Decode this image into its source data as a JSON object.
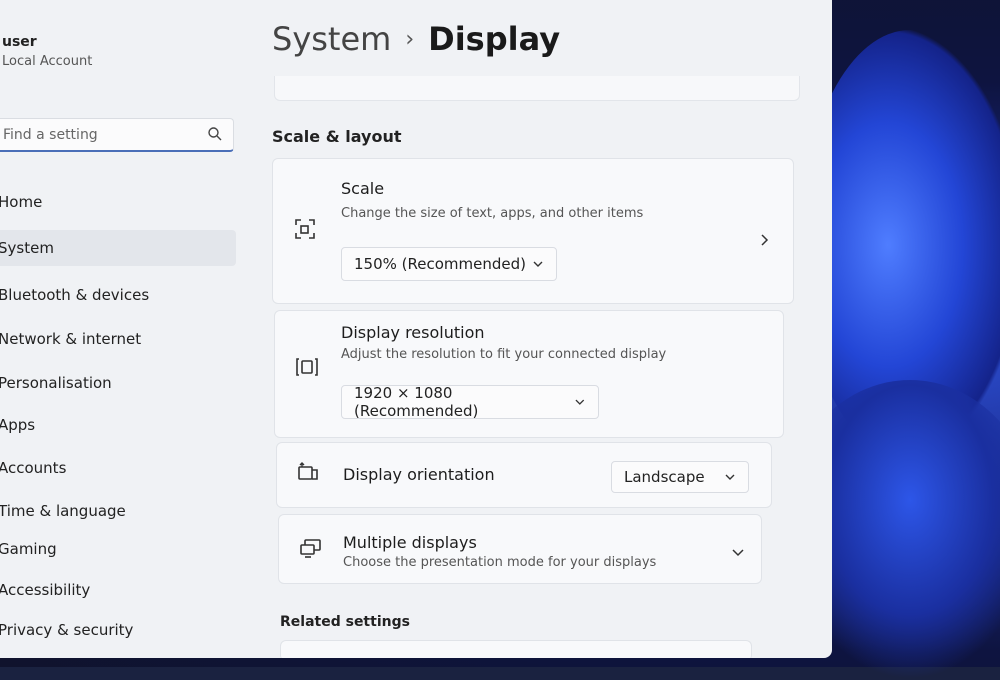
{
  "user": {
    "name": "user",
    "account": "Local Account"
  },
  "search": {
    "placeholder": "Find a setting"
  },
  "sidebar": {
    "items": [
      {
        "label": "Home"
      },
      {
        "label": "System"
      },
      {
        "label": "Bluetooth & devices"
      },
      {
        "label": "Network & internet"
      },
      {
        "label": "Personalisation"
      },
      {
        "label": "Apps"
      },
      {
        "label": "Accounts"
      },
      {
        "label": "Time & language"
      },
      {
        "label": "Gaming"
      },
      {
        "label": "Accessibility"
      },
      {
        "label": "Privacy & security"
      }
    ],
    "active_index": 1
  },
  "breadcrumb": {
    "parent": "System",
    "separator": "›",
    "current": "Display"
  },
  "section": {
    "title": "Scale & layout"
  },
  "scale": {
    "title": "Scale",
    "subtitle": "Change the size of text, apps, and other items",
    "value": "150% (Recommended)",
    "icon": "scale-icon"
  },
  "resolution": {
    "title": "Display resolution",
    "subtitle": "Adjust the resolution to fit your connected display",
    "value": "1920 × 1080 (Recommended)",
    "icon": "resolution-icon"
  },
  "orientation": {
    "title": "Display orientation",
    "value": "Landscape",
    "icon": "orientation-icon"
  },
  "multiple": {
    "title": "Multiple displays",
    "subtitle": "Choose the presentation mode for your displays",
    "icon": "multiple-displays-icon"
  },
  "related": {
    "title": "Related settings"
  },
  "colors": {
    "accent": "#4a6fb8",
    "window_bg": "#f0f2f5",
    "card_bg": "#f8f9fb"
  }
}
